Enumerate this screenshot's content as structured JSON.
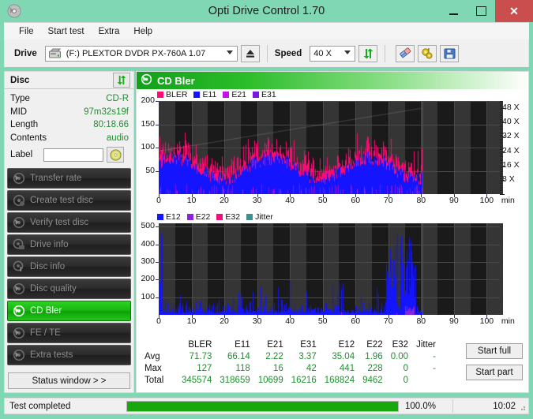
{
  "window": {
    "title": "Opti Drive Control 1.70",
    "app_icon": "disc-icon",
    "minimize_label": "–",
    "maximize_label": "□",
    "close_label": "✕",
    "accent_color": "#7fd7b4",
    "close_color": "#cb4e4e"
  },
  "menu": {
    "items": [
      "File",
      "Start test",
      "Extra",
      "Help"
    ]
  },
  "toolbar": {
    "drive_label": "Drive",
    "drive_value": "(F:)   PLEXTOR DVDR   PX-760A 1.07",
    "eject_icon": "eject-icon",
    "speed_label": "Speed",
    "speed_value": "40 X",
    "refresh_icon": "refresh-icon",
    "eraser_icon": "eraser-icon",
    "tools_icon": "gear-icon",
    "save_icon": "save-icon"
  },
  "disc": {
    "header": "Disc",
    "refresh_icon": "refresh-icon",
    "rows": [
      {
        "key": "Type",
        "value": "CD-R"
      },
      {
        "key": "MID",
        "value": "97m32s19f"
      },
      {
        "key": "Length",
        "value": "80:18.66"
      },
      {
        "key": "Contents",
        "value": "audio"
      }
    ],
    "label_key": "Label",
    "label_value": "",
    "label_placeholder": "",
    "disc_button_icon": "cd-icon"
  },
  "nav": {
    "items": [
      {
        "label": "Transfer rate",
        "icon": "disc-icon",
        "active": false
      },
      {
        "label": "Create test disc",
        "icon": "disc-write-icon",
        "active": false
      },
      {
        "label": "Verify test disc",
        "icon": "disc-check-icon",
        "active": false
      },
      {
        "label": "Drive info",
        "icon": "drive-icon",
        "active": false
      },
      {
        "label": "Disc info",
        "icon": "disc-info-icon",
        "active": false
      },
      {
        "label": "Disc quality",
        "icon": "disc-quality-icon",
        "active": false
      },
      {
        "label": "CD Bler",
        "icon": "disc-bler-icon",
        "active": true
      },
      {
        "label": "FE / TE",
        "icon": "disc-fete-icon",
        "active": false
      },
      {
        "label": "Extra tests",
        "icon": "disc-extra-icon",
        "active": false
      }
    ],
    "status_window": "Status window > >"
  },
  "panel": {
    "title": "CD Bler",
    "title_icon": "disc-bler-icon"
  },
  "chart_data": [
    {
      "type": "area",
      "name": "cd-bler-top-chart",
      "title": "",
      "xlabel": "min",
      "ylabel": "",
      "xlim": [
        0,
        104
      ],
      "ylim": [
        0,
        200
      ],
      "xticks": [
        0,
        10,
        20,
        30,
        40,
        50,
        60,
        70,
        80,
        90,
        100
      ],
      "xtick_labels": [
        "0",
        "10",
        "20",
        "30",
        "40",
        "50",
        "60",
        "70",
        "80",
        "90",
        "100"
      ],
      "xunit": "min",
      "yticks": [
        50,
        100,
        150,
        200
      ],
      "y2ticks": [
        8,
        16,
        24,
        32,
        40,
        48
      ],
      "y2tick_labels": [
        "8 X",
        "16 X",
        "24 X",
        "32 X",
        "40 X",
        "48 X"
      ],
      "y2lim": [
        0,
        52
      ],
      "grid": true,
      "data_end_min": 80.4,
      "end_marker_color": "#ee1111",
      "legend_position": "top-left",
      "legend": [
        {
          "name": "BLER",
          "color": "#ff0a74"
        },
        {
          "name": "E11",
          "color": "#1414ff"
        },
        {
          "name": "E21",
          "color": "#c413e8"
        },
        {
          "name": "E31",
          "color": "#7a17e0"
        }
      ],
      "series": [
        {
          "name": "BLER",
          "color": "#ff0a74",
          "avg": 71.73,
          "max": 127,
          "total": 345574
        },
        {
          "name": "E11",
          "color": "#1414ff",
          "avg": 66.14,
          "max": 118,
          "total": 318659
        },
        {
          "name": "E21",
          "color": "#c413e8",
          "avg": 2.22,
          "max": 16,
          "total": 10699
        },
        {
          "name": "E31",
          "color": "#7a17e0",
          "avg": 3.37,
          "max": 42,
          "total": 16216
        }
      ]
    },
    {
      "type": "area",
      "name": "cd-bler-bottom-chart",
      "title": "",
      "xlabel": "min",
      "ylabel": "",
      "xlim": [
        0,
        104
      ],
      "ylim": [
        0,
        520
      ],
      "xticks": [
        0,
        10,
        20,
        30,
        40,
        50,
        60,
        70,
        80,
        90,
        100
      ],
      "xtick_labels": [
        "0",
        "10",
        "20",
        "30",
        "40",
        "50",
        "60",
        "70",
        "80",
        "90",
        "100"
      ],
      "xunit": "min",
      "yticks": [
        100,
        200,
        300,
        400,
        500
      ],
      "grid": true,
      "data_end_min": 80.4,
      "end_marker_color": "#ee1111",
      "legend_position": "top-left",
      "legend": [
        {
          "name": "E12",
          "color": "#1414ff"
        },
        {
          "name": "E22",
          "color": "#8a23d8"
        },
        {
          "name": "E32",
          "color": "#f0107a"
        },
        {
          "name": "Jitter",
          "color": "#3f8f8f"
        }
      ],
      "series": [
        {
          "name": "E12",
          "color": "#1414ff",
          "avg": 35.04,
          "max": 441,
          "total": 168824
        },
        {
          "name": "E22",
          "color": "#8a23d8",
          "avg": 1.96,
          "max": 228,
          "total": 9462
        },
        {
          "name": "E32",
          "color": "#f0107a",
          "avg": 0.0,
          "max": 0,
          "total": 0
        },
        {
          "name": "Jitter",
          "color": "#3f8f8f",
          "avg": "-",
          "max": "-",
          "total": ""
        }
      ]
    }
  ],
  "stats": {
    "columns": [
      "BLER",
      "E11",
      "E21",
      "E31",
      "E12",
      "E22",
      "E32",
      "Jitter"
    ],
    "rows": [
      {
        "label": "Avg",
        "values": [
          "71.73",
          "66.14",
          "2.22",
          "3.37",
          "35.04",
          "1.96",
          "0.00",
          "-"
        ]
      },
      {
        "label": "Max",
        "values": [
          "127",
          "118",
          "16",
          "42",
          "441",
          "228",
          "0",
          "-"
        ]
      },
      {
        "label": "Total",
        "values": [
          "345574",
          "318659",
          "10699",
          "16216",
          "168824",
          "9462",
          "0",
          ""
        ]
      }
    ]
  },
  "actions": {
    "start_full": "Start full",
    "start_part": "Start part"
  },
  "statusbar": {
    "message": "Test completed",
    "progress_percent": 100.0,
    "progress_text": "100.0%",
    "elapsed": "10:02"
  }
}
